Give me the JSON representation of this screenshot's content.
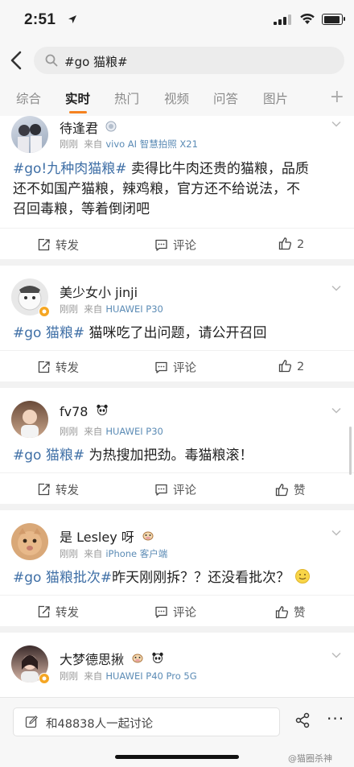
{
  "status": {
    "time": "2:51"
  },
  "search": {
    "query": "#go 猫粮#"
  },
  "tabs": [
    "综合",
    "实时",
    "热门",
    "视频",
    "问答",
    "图片"
  ],
  "active_tab": "实时",
  "posts": [
    {
      "name": "待逢君",
      "time": "刚刚",
      "source_prefix": "来自",
      "source": "vivo AI 智慧拍照 X21",
      "hashtag": "#go!九种肉猫粮#",
      "text_line1": " 卖得比牛肉还贵的猫粮，品质",
      "text_line2": "还不如国产猫粮，辣鸡粮，官方还不给说法，不",
      "text_line3": "召回毒粮，等着倒闭吧",
      "repost": "转发",
      "comment": "评论",
      "likes": "2"
    },
    {
      "name": "美少女小 jinji",
      "time": "刚刚",
      "source_prefix": "来自",
      "source": "HUAWEI P30",
      "hashtag": "#go 猫粮#",
      "text_line1": " 猫咪吃了出问题，请公开召回",
      "repost": "转发",
      "comment": "评论",
      "likes": "2"
    },
    {
      "name": "fv78",
      "time": "刚刚",
      "source_prefix": "来自",
      "source": "HUAWEI P30",
      "hashtag": "#go 猫粮#",
      "text_line1": " 为热搜加把劲。毒猫粮滚！",
      "repost": "转发",
      "comment": "评论",
      "likes": "赞"
    },
    {
      "name": "是 Lesley 呀",
      "time": "刚刚",
      "source_prefix": "来自",
      "source": "iPhone 客户端",
      "hashtag": "#go 猫粮批次#",
      "text_line1": "昨天刚刚拆？？还没看批次？",
      "repost": "转发",
      "comment": "评论",
      "likes": "赞"
    },
    {
      "name": "大梦德思揪",
      "time": "刚刚",
      "source_prefix": "来自",
      "source": "HUAWEI P40 Pro 5G"
    }
  ],
  "bottom": {
    "discuss_label": "和48838人一起讨论",
    "more": "···"
  },
  "watermark": "@猫圈杀神",
  "colors": {
    "accent": "#f58220",
    "hashtag": "#3f6fa6",
    "source": "#5b8bb5"
  }
}
